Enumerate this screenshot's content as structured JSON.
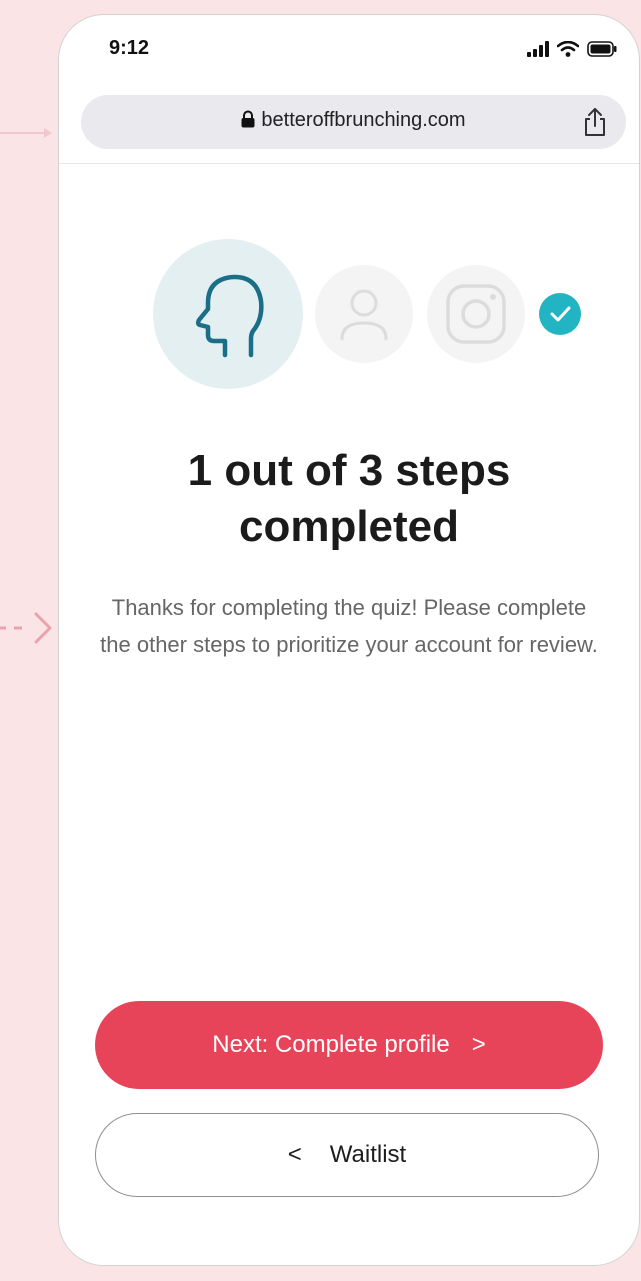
{
  "status_bar": {
    "time": "9:12",
    "icons": [
      "signal-icon",
      "wifi-icon",
      "battery-icon"
    ]
  },
  "browser": {
    "url": "betteroffbrunching.com",
    "lock_icon": "lock-icon",
    "share_icon": "share-icon"
  },
  "progress": {
    "completed": 1,
    "total": 3,
    "steps": [
      {
        "icon": "head-profile-icon",
        "state": "active"
      },
      {
        "icon": "person-icon",
        "state": "inactive"
      },
      {
        "icon": "instagram-icon",
        "state": "inactive"
      }
    ],
    "status_icon": "check-icon"
  },
  "content": {
    "title_line1": "1 out of 3 steps",
    "title_line2": "completed",
    "description": "Thanks for completing the quiz! Please complete the other steps to prioritize your account for review."
  },
  "actions": {
    "primary_label": "Next: Complete profile",
    "primary_chevron": ">",
    "secondary_label": "Waitlist",
    "secondary_chevron": "<"
  },
  "colors": {
    "page_background": "#fbe4e6",
    "accent_red": "#e84459",
    "accent_teal": "#22b4c2",
    "head_icon": "#1a6e87",
    "step_active_bg": "#e3eff0",
    "step_inactive_bg": "#f4f4f4"
  }
}
